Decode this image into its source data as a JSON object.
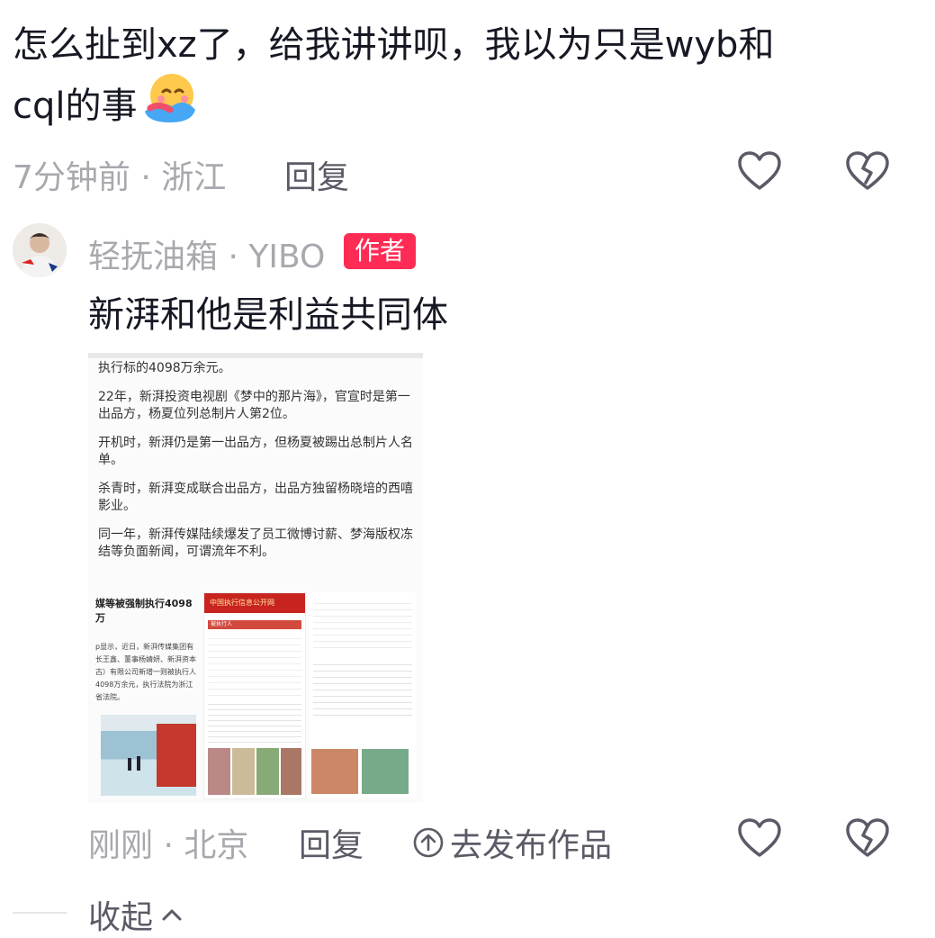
{
  "comment1": {
    "text_line1": "怎么扯到xz了，给我讲讲呗，我以为只是wyb和",
    "text_line2": "cql的事",
    "emoji": "hugging-face-emoji",
    "meta": "7分钟前 · 浙江",
    "reply_label": "回复"
  },
  "comment2": {
    "username": "轻抚油箱 · YIBO",
    "badge": "作者",
    "text": "新湃和他是利益共同体",
    "meta": "刚刚 · 北京",
    "reply_label": "回复",
    "publish_label": "去发布作品",
    "image": {
      "paragraphs": [
        "执行标的4098万余元。",
        "22年，新湃投资电视剧《梦中的那片海》，官宣时是第一出品方，杨夏位列总制片人第2位。",
        "开机时，新湃仍是第一出品方，但杨夏被踢出总制片人名单。",
        "杀青时，新湃变成联合出品方，出品方独留杨晓培的西嘻影业。",
        "同一年，新湃传媒陆续爆发了员工微博讨薪、梦海版权冻结等负面新闻，可谓流年不利。"
      ],
      "news_title": "媒等被强制执行4098万",
      "news_body": "p显示，近日，新湃传媒集团有长王鑫、董事杨婧妍、新湃资本古）有限公司新增一则被执行人4098万余元，执行法院为浙江省法院。",
      "court_title": "中国执行信息公开网",
      "court_section": "被执行人"
    }
  },
  "collapse_label": "收起",
  "colors": {
    "accent": "#fe2c55",
    "muted": "#a8a9ae",
    "text": "#161823"
  }
}
